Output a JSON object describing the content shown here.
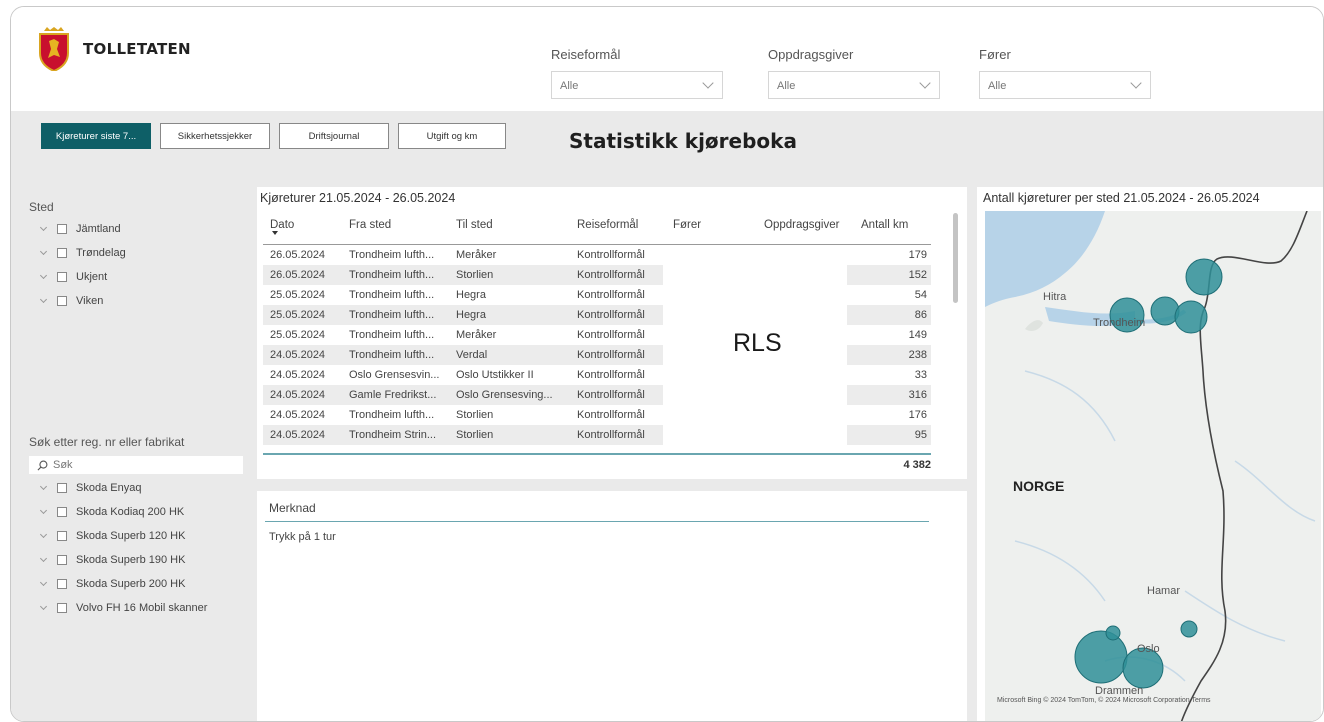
{
  "header": {
    "brand": "TOLLETATEN",
    "filters": [
      {
        "label": "Reiseformål",
        "value": "Alle"
      },
      {
        "label": "Oppdragsgiver",
        "value": "Alle"
      },
      {
        "label": "Fører",
        "value": "Alle"
      }
    ]
  },
  "tabs": [
    {
      "label": "Kjøreturer siste 7...",
      "active": true
    },
    {
      "label": "Sikkerhetssjekker",
      "active": false
    },
    {
      "label": "Driftsjournal",
      "active": false
    },
    {
      "label": "Utgift og km",
      "active": false
    }
  ],
  "page_title": "Statistikk kjøreboka",
  "sidebar": {
    "sted_label": "Sted",
    "sted_items": [
      "Jämtland",
      "Trøndelag",
      "Ukjent",
      "Viken"
    ],
    "search_label": "Søk etter reg. nr eller fabrikat",
    "search_placeholder": "Søk",
    "vehicle_items": [
      "Skoda Enyaq",
      "Skoda Kodiaq 200 HK",
      "Skoda Superb 120 HK",
      "Skoda Superb 190 HK",
      "Skoda Superb 200 HK",
      "Volvo FH 16 Mobil skanner"
    ]
  },
  "table": {
    "title": "Kjøreturer 21.05.2024 - 26.05.2024",
    "columns": [
      "Dato",
      "Fra sted",
      "Til sted",
      "Reiseformål",
      "Fører",
      "Oppdragsgiver",
      "Antall km"
    ],
    "rows": [
      {
        "dato": "26.05.2024",
        "fra": "Trondheim lufth...",
        "til": "Meråker",
        "formal": "Kontrollformål",
        "km": "179"
      },
      {
        "dato": "26.05.2024",
        "fra": "Trondheim lufth...",
        "til": "Storlien",
        "formal": "Kontrollformål",
        "km": "152"
      },
      {
        "dato": "25.05.2024",
        "fra": "Trondheim lufth...",
        "til": "Hegra",
        "formal": "Kontrollformål",
        "km": "54"
      },
      {
        "dato": "25.05.2024",
        "fra": "Trondheim lufth...",
        "til": "Hegra",
        "formal": "Kontrollformål",
        "km": "86"
      },
      {
        "dato": "25.05.2024",
        "fra": "Trondheim lufth...",
        "til": "Meråker",
        "formal": "Kontrollformål",
        "km": "149"
      },
      {
        "dato": "24.05.2024",
        "fra": "Trondheim lufth...",
        "til": "Verdal",
        "formal": "Kontrollformål",
        "km": "238"
      },
      {
        "dato": "24.05.2024",
        "fra": "Oslo Grensesvin...",
        "til": "Oslo Utstikker II",
        "formal": "Kontrollformål",
        "km": "33"
      },
      {
        "dato": "24.05.2024",
        "fra": "Gamle Fredrikst...",
        "til": "Oslo Grensesving...",
        "formal": "Kontrollformål",
        "km": "316"
      },
      {
        "dato": "24.05.2024",
        "fra": "Trondheim lufth...",
        "til": "Storlien",
        "formal": "Kontrollformål",
        "km": "176"
      },
      {
        "dato": "24.05.2024",
        "fra": "Trondheim Strin...",
        "til": "Storlien",
        "formal": "Kontrollformål",
        "km": "95"
      }
    ],
    "redaction": "RLS",
    "total": "4 382"
  },
  "notes": {
    "label": "Merknad",
    "hint": "Trykk på 1 tur"
  },
  "map": {
    "title": "Antall kjøreturer per sted 21.05.2024 - 26.05.2024",
    "labels": {
      "hitra": "Hitra",
      "trondheim": "Trondheim",
      "norge": "NORGE",
      "hamar": "Hamar",
      "oslo": "Oslo",
      "drammen": "Drammen"
    },
    "credit": "Microsoft Bing   © 2024 TomTom, © 2024 Microsoft Corporation  Terms",
    "colors": {
      "bubble": "#2f8f98",
      "water": "#b7d3e8",
      "land": "#eef0ee"
    }
  }
}
